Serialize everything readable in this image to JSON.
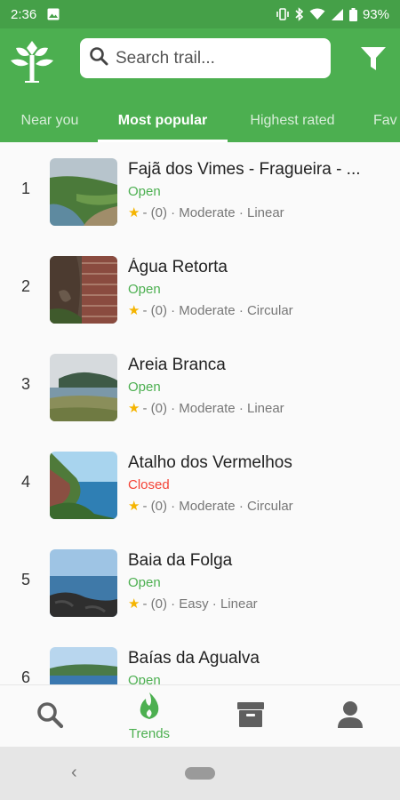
{
  "status_bar": {
    "time": "2:36",
    "battery": "93%"
  },
  "search": {
    "placeholder": "Search trail..."
  },
  "tabs": [
    {
      "label": "Near you"
    },
    {
      "label": "Most popular"
    },
    {
      "label": "Highest rated"
    },
    {
      "label": "Fav"
    }
  ],
  "trails": [
    {
      "rank": "1",
      "name": "Fajã dos Vimes - Fragueira - ...",
      "status": "Open",
      "rating": "- (0) · Moderate · Linear"
    },
    {
      "rank": "2",
      "name": "Água Retorta",
      "status": "Open",
      "rating": "- (0) · Moderate · Circular"
    },
    {
      "rank": "3",
      "name": "Areia Branca",
      "status": "Open",
      "rating": "- (0) · Moderate · Linear"
    },
    {
      "rank": "4",
      "name": "Atalho dos Vermelhos",
      "status": "Closed",
      "rating": "- (0) · Moderate · Circular"
    },
    {
      "rank": "5",
      "name": "Baia da Folga",
      "status": "Open",
      "rating": "- (0) · Easy · Linear"
    },
    {
      "rank": "6",
      "name": "Baías da Agualva",
      "status": "Open",
      "rating": ""
    }
  ],
  "bottom_nav": {
    "trends_label": "Trends"
  },
  "colors": {
    "primary": "#4caf50",
    "status_bar": "#45a048",
    "open": "#4caf50",
    "closed": "#f44336",
    "star": "#f5b400"
  }
}
